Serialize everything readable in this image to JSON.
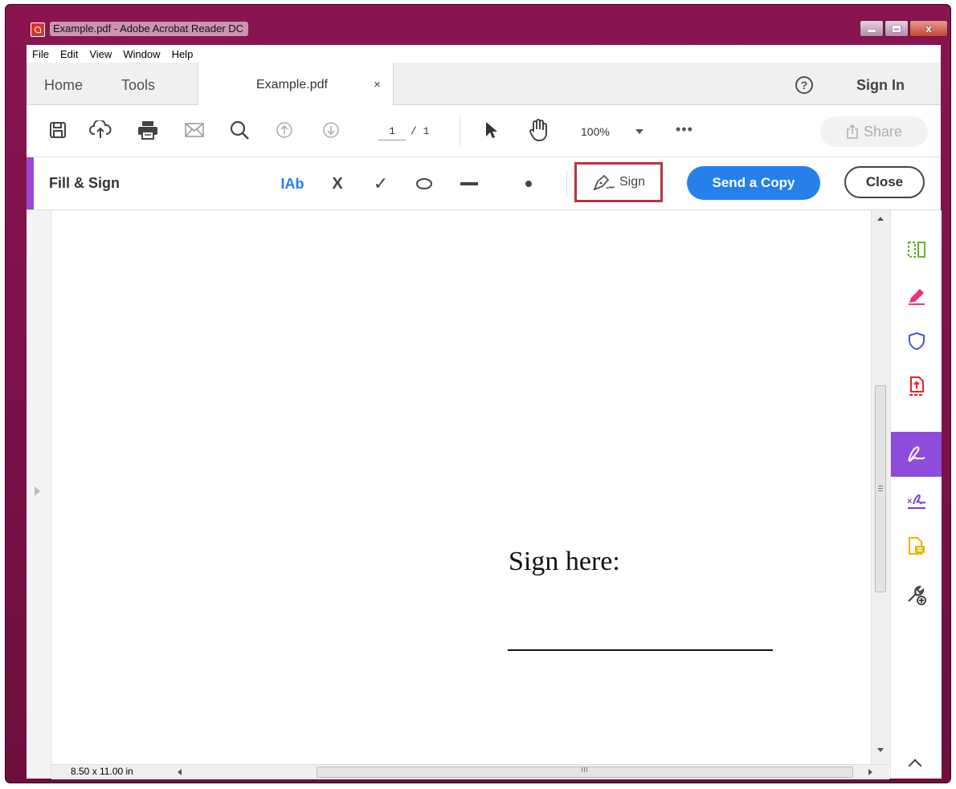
{
  "window": {
    "title": "Example.pdf - Adobe Acrobat Reader DC",
    "controls": {
      "minimize": "minimize",
      "maximize": "maximize",
      "close": "x"
    }
  },
  "menu": [
    "File",
    "Edit",
    "View",
    "Window",
    "Help"
  ],
  "tabs": {
    "home": "Home",
    "tools": "Tools",
    "document": "Example.pdf",
    "document_close": "×",
    "help": "?",
    "sign_in": "Sign In"
  },
  "toolbar": {
    "icons": [
      "save-icon",
      "upload-icon",
      "print-icon",
      "email-icon",
      "search-icon",
      "prev-page-icon",
      "next-page-icon",
      "select-cursor-icon",
      "hand-tool-icon"
    ],
    "page_current": "1",
    "page_total": "/ 1",
    "zoom": "100%",
    "more": "•••",
    "share": "Share"
  },
  "fill_sign": {
    "title": "Fill & Sign",
    "tools": {
      "text": "IAb",
      "cross": "X",
      "check": "✓",
      "circle": "circle",
      "line": "line",
      "dot": "dot"
    },
    "sign": "Sign",
    "send_copy": "Send a Copy",
    "close": "Close"
  },
  "document": {
    "sign_here": "Sign here:"
  },
  "status": {
    "page_size": "8.50 x 11.00 in"
  },
  "right_rail": [
    "organize-pages-icon",
    "edit-pdf-icon",
    "protect-icon",
    "export-pdf-icon",
    "fill-sign-icon",
    "request-signature-icon",
    "comment-icon",
    "more-tools-icon"
  ],
  "colors": {
    "accent_purple": "#9a4ad6",
    "send_blue": "#2680eb",
    "highlight_red": "#b5363b",
    "title_bar": "#7a1147"
  }
}
